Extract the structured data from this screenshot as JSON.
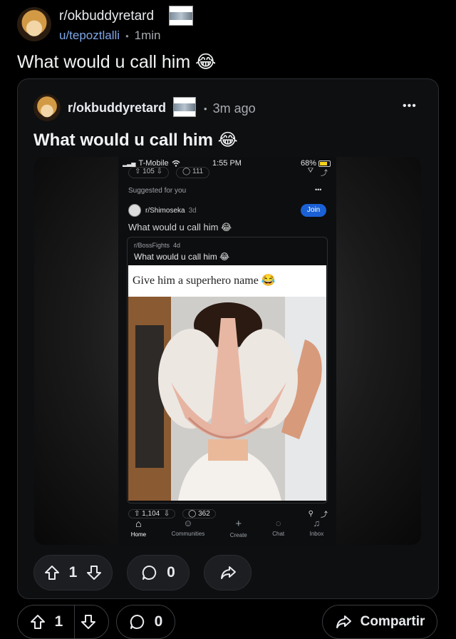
{
  "post": {
    "subreddit": "r/okbuddyretard",
    "author": "u/tepoztlalli",
    "separator": "•",
    "age": "1min",
    "title": "What would u call him 😂"
  },
  "crosspost": {
    "subreddit": "r/okbuddyretard",
    "separator": "•",
    "age": "3m ago",
    "menu": "•••",
    "title": "What would u call him 😂",
    "upvotes": "1",
    "comments": "0"
  },
  "screenshot": {
    "status_carrier": "T-Mobile",
    "status_time": "1:55 PM",
    "status_battery": "68%",
    "top_counts": [
      "105",
      "111"
    ],
    "suggested": "Suggested for you",
    "menu": "•••",
    "sub": "r/Shimoseka",
    "sub_age": "3d",
    "join": "Join",
    "title": "What would u call him 😂",
    "inner_sub": "r/BossFights",
    "inner_age": "4d",
    "inner_title": "What would u call him 😂",
    "meme_caption": "Give him a superhero name 😂",
    "upvotes": "1,104",
    "comments": "362",
    "nav": [
      "Home",
      "Communities",
      "Create",
      "Chat",
      "Inbox"
    ]
  },
  "actions": {
    "upvotes": "1",
    "comments": "0",
    "share": "Compartir"
  },
  "colors": {
    "background": "#000000",
    "card": "#0e0f11",
    "author_link": "#7fa6e8",
    "join_button": "#1a61d6"
  }
}
